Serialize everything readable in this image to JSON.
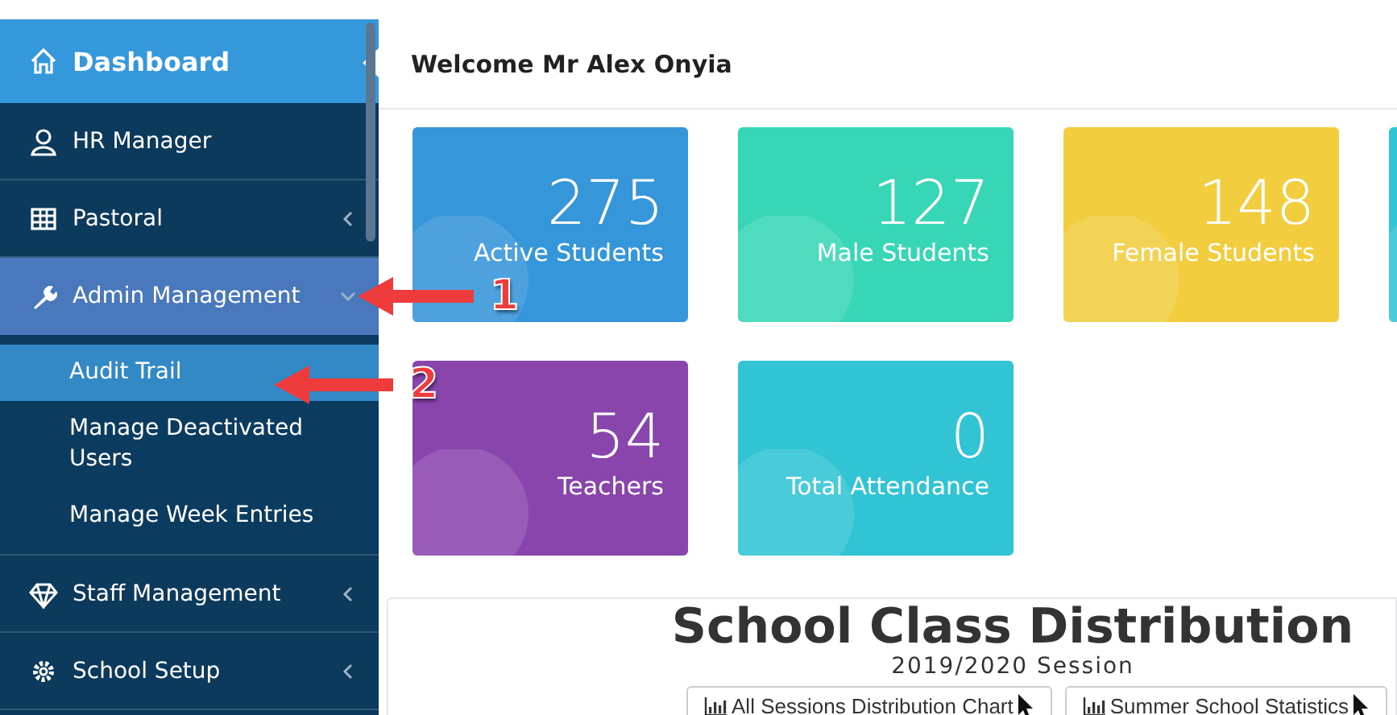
{
  "sidebar": {
    "items": [
      {
        "label": "Dashboard",
        "kind": "top",
        "selected": true
      },
      {
        "label": "HR Manager",
        "kind": "main",
        "selected": false
      },
      {
        "label": "Pastoral",
        "kind": "main",
        "selected": false,
        "expanded": false
      },
      {
        "label": "Admin Management",
        "kind": "main",
        "selected": true,
        "expanded": true,
        "children": [
          {
            "label": "Audit Trail",
            "selected": true
          },
          {
            "label": "Manage Deactivated Users",
            "selected": false
          },
          {
            "label": "Manage Week Entries",
            "selected": false
          }
        ]
      },
      {
        "label": "Staff Management",
        "kind": "main",
        "selected": false,
        "expanded": false
      },
      {
        "label": "School Setup",
        "kind": "main",
        "selected": false,
        "expanded": false
      }
    ]
  },
  "header": {
    "welcome": "Welcome Mr Alex Onyia"
  },
  "cards": [
    {
      "value": "275",
      "label": "Active Students",
      "color": "#3596da"
    },
    {
      "value": "127",
      "label": "Male Students",
      "color": "#37d6b6"
    },
    {
      "value": "148",
      "label": "Female Students",
      "color": "#f2cd3e"
    },
    {
      "color": "#31c4d5"
    },
    {
      "value": "54",
      "label": "Teachers",
      "color": "#8a45ad"
    },
    {
      "value": "0",
      "label": "Total Attendance",
      "color": "#31c4d5"
    }
  ],
  "chart_panel": {
    "title": "School Class Distribution",
    "subtitle": "2019/2020 Session",
    "buttons": [
      "All Sessions Distribution Chart",
      "Summer School Statistics"
    ]
  },
  "callouts": [
    {
      "label": "1"
    },
    {
      "label": "2"
    }
  ]
}
